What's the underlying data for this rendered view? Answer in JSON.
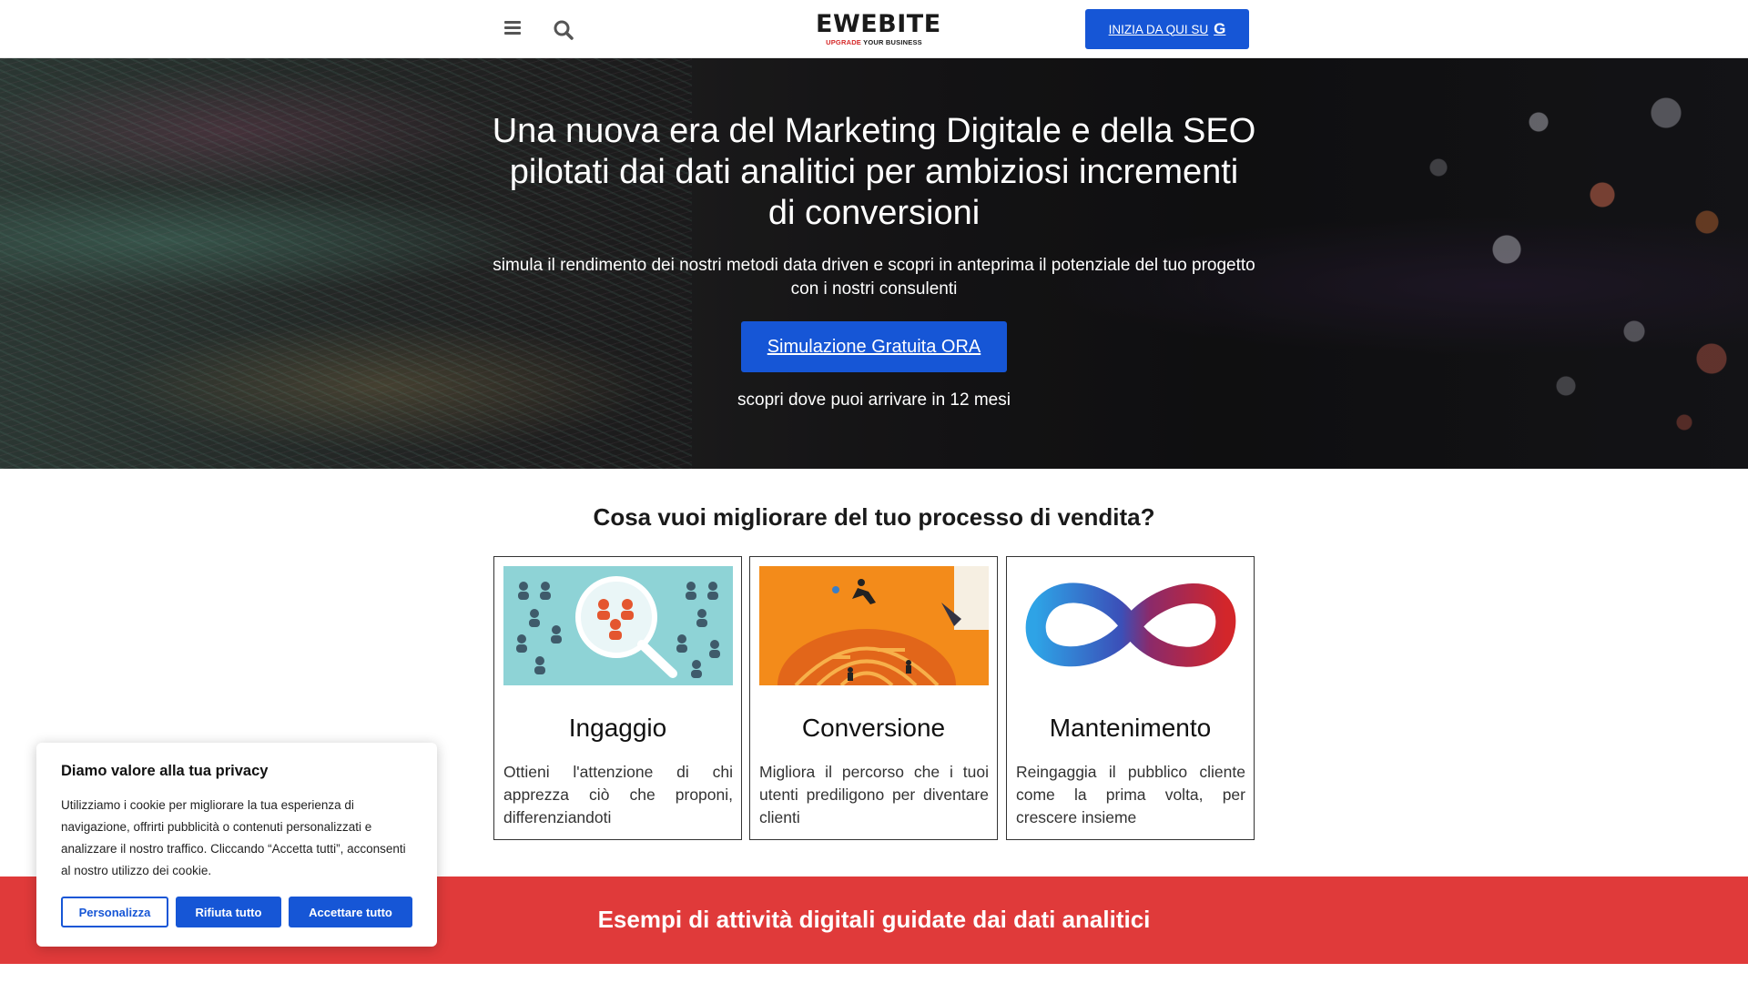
{
  "header": {
    "logo_main": "EWEBITE",
    "logo_sub_red": "UPGRADE",
    "logo_sub_rest": "YOUR BUSINESS",
    "cta_label": "INIZIA DA QUI SU",
    "cta_icon": "G"
  },
  "hero": {
    "title": "Una nuova era del Marketing Digitale e della SEO pilotati dai dati analitici per ambiziosi incrementi di conversioni",
    "subtitle": "simula il rendimento dei nostri metodi data driven e scopri in anteprima il potenziale del tuo progetto con i nostri consulenti",
    "button_label": "Simulazione Gratuita ORA",
    "note": "scopri dove puoi arrivare in 12 mesi"
  },
  "section": {
    "title": "Cosa vuoi migliorare del tuo processo di vendita?",
    "cards": [
      {
        "title": "Ingaggio",
        "text": "Ottieni l'attenzione di chi apprezza ciò che proponi, differenziandoti"
      },
      {
        "title": "Conversione",
        "text": "Migliora il percorso che i tuoi utenti prediligono per diventare clienti"
      },
      {
        "title": "Mantenimento",
        "text": "Reingaggia il pubblico cliente come la prima volta, per crescere insieme"
      }
    ]
  },
  "band": {
    "title": "Esempi di attività digitali guidate dai dati analitici"
  },
  "cookie": {
    "title": "Diamo valore alla tua privacy",
    "text": "Utilizziamo i cookie per migliorare la tua esperienza di navigazione, offrirti pubblicità o contenuti personalizzati e analizzare il nostro traffico. Cliccando “Accetta tutti”, acconsenti al nostro utilizzo dei cookie.",
    "customize_label": "Personalizza",
    "reject_label": "Rifiuta tutto",
    "accept_label": "Accettare tutto"
  },
  "colors": {
    "primary_blue": "#1656d6",
    "band_red": "#e03a3a",
    "logo_red": "#d62828"
  },
  "icons": [
    "menu-icon",
    "search-icon",
    "google-icon"
  ]
}
